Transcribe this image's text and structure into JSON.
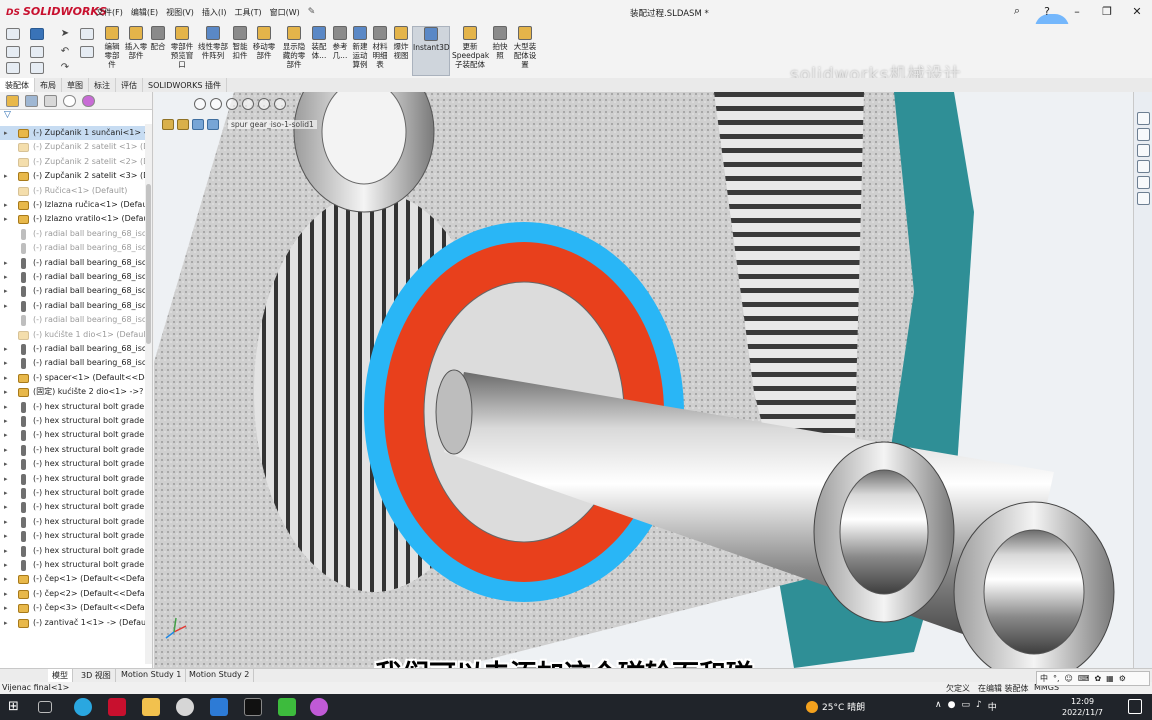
{
  "app": {
    "logo_ds": "DS",
    "logo_text": "SOLIDWORKS",
    "menus": [
      "文件(F)",
      "编辑(E)",
      "视图(V)",
      "插入(I)",
      "工具(T)",
      "窗口(W)"
    ],
    "document_title": "装配过程.SLDASM *",
    "clock_badge": "01:29"
  },
  "commands": [
    {
      "label": "编辑\n零部\n件",
      "color": "#e4b44a"
    },
    {
      "label": "插入零\n部件",
      "color": "#e4b44a"
    },
    {
      "label": "配合",
      "color": "#8a8a8a"
    },
    {
      "label": "零部件\n预览窗\n口",
      "color": "#e4b44a"
    },
    {
      "label": "线性零部\n件阵列",
      "color": "#5a88c6"
    },
    {
      "label": "智能\n扣件",
      "color": "#8a8a8a"
    },
    {
      "label": "移动零\n部件",
      "color": "#e4b44a"
    },
    {
      "label": "显示隐\n藏的零\n部件",
      "color": "#e4b44a"
    },
    {
      "label": "装配\n体...",
      "color": "#5a88c6"
    },
    {
      "label": "参考\n几...",
      "color": "#8a8a8a"
    },
    {
      "label": "新建\n运动\n算例",
      "color": "#5a88c6"
    },
    {
      "label": "材料\n明细\n表",
      "color": "#8a8a8a"
    },
    {
      "label": "爆炸\n视图",
      "color": "#e4b44a"
    },
    {
      "label": "Instant3D",
      "color": "#5a88c6",
      "active": true
    },
    {
      "label": "更新\nSpeedpak\n子装配体",
      "color": "#e4b44a"
    },
    {
      "label": "拍快\n照",
      "color": "#8a8a8a"
    },
    {
      "label": "大型装\n配体设\n置",
      "color": "#e4b44a"
    }
  ],
  "watermark": "solidworks机械设计",
  "tabs": [
    "装配体",
    "布局",
    "草图",
    "标注",
    "评估",
    "SOLIDWORKS 插件"
  ],
  "feature_tree": [
    {
      "label": "(-) Zupčanik 1 sunčani<1> -",
      "icon": "asm",
      "expand": "▸",
      "selected": true
    },
    {
      "label": "(-) Zupčanik 2 satelit <1> (D",
      "icon": "asm",
      "suppressed": true
    },
    {
      "label": "(-) Zupčanik 2 satelit <2> (D",
      "icon": "asm",
      "suppressed": true
    },
    {
      "label": "(-) Zupčanik 2 satelit <3> (D",
      "icon": "asm",
      "expand": "▸"
    },
    {
      "label": "(-) Ručica<1> (Default)",
      "icon": "asm",
      "suppressed": true
    },
    {
      "label": "(-) Izlazna ručica<1> (Defau",
      "icon": "asm",
      "expand": "▸"
    },
    {
      "label": "(-) Izlazno vratilo<1> (Defau",
      "icon": "asm",
      "expand": "▸"
    },
    {
      "label": "(-) radial ball bearing_68_isc",
      "icon": "bolt",
      "suppressed": true
    },
    {
      "label": "(-) radial ball bearing_68_isc",
      "icon": "bolt",
      "suppressed": true
    },
    {
      "label": "(-) radial ball bearing_68_isc",
      "icon": "bolt",
      "expand": "▸"
    },
    {
      "label": "(-) radial ball bearing_68_isc",
      "icon": "bolt",
      "expand": "▸"
    },
    {
      "label": "(-) radial ball bearing_68_isc",
      "icon": "bolt",
      "expand": "▸"
    },
    {
      "label": "(-) radial ball bearing_68_isc",
      "icon": "bolt",
      "expand": "▸"
    },
    {
      "label": "(-) radial ball bearing_68_isc",
      "icon": "bolt",
      "suppressed": true
    },
    {
      "label": "(-) kućište 1 dio<1> (Default",
      "icon": "asm",
      "suppressed": true
    },
    {
      "label": "(-) radial ball bearing_68_isc",
      "icon": "bolt",
      "expand": "▸"
    },
    {
      "label": "(-) radial ball bearing_68_isc",
      "icon": "bolt",
      "expand": "▸"
    },
    {
      "label": "(-) spacer<1> (Default<<De",
      "icon": "asm",
      "expand": "▸"
    },
    {
      "label": "(固定) kućište 2 dio<1> ->? (",
      "icon": "asm",
      "expand": "▸"
    },
    {
      "label": "(-) hex structural bolt grade",
      "icon": "bolt",
      "expand": "▸"
    },
    {
      "label": "(-) hex structural bolt grade",
      "icon": "bolt",
      "expand": "▸"
    },
    {
      "label": "(-) hex structural bolt grade",
      "icon": "bolt",
      "expand": "▸"
    },
    {
      "label": "(-) hex structural bolt grade",
      "icon": "bolt",
      "expand": "▸"
    },
    {
      "label": "(-) hex structural bolt grade",
      "icon": "bolt",
      "expand": "▸"
    },
    {
      "label": "(-) hex structural bolt grade",
      "icon": "bolt",
      "expand": "▸"
    },
    {
      "label": "(-) hex structural bolt grade",
      "icon": "bolt",
      "expand": "▸"
    },
    {
      "label": "(-) hex structural bolt grade",
      "icon": "bolt",
      "expand": "▸"
    },
    {
      "label": "(-) hex structural bolt grade",
      "icon": "bolt",
      "expand": "▸"
    },
    {
      "label": "(-) hex structural bolt grade",
      "icon": "bolt",
      "expand": "▸"
    },
    {
      "label": "(-) hex structural bolt grade",
      "icon": "bolt",
      "expand": "▸"
    },
    {
      "label": "(-) hex structural bolt grade",
      "icon": "bolt",
      "expand": "▸"
    },
    {
      "label": "(-) čep<1> (Default<<Defa",
      "icon": "asm",
      "expand": "▸"
    },
    {
      "label": "(-) čep<2> (Default<<Defau",
      "icon": "asm",
      "expand": "▸"
    },
    {
      "label": "(-) čep<3> (Default<<Defau",
      "icon": "asm",
      "expand": "▸"
    },
    {
      "label": "(-) zantivač 1<1> -> (Defau",
      "icon": "asm",
      "expand": "▸"
    }
  ],
  "breadcrumb": "spur gear_iso-1-solid1",
  "subtitle": "我们可以去添加这个磁轮面和磁",
  "bottom_tabs": [
    "模型",
    "3D 视图",
    "Motion Study 1",
    "Motion Study 2"
  ],
  "status": {
    "left": "Vijenac final<1>",
    "middle1": "欠定义",
    "middle2": "在编辑 装配体",
    "units": "MMGS"
  },
  "ime": [
    "中",
    "°,",
    "☺",
    "⌨",
    "✿",
    "▦",
    "⚙"
  ],
  "taskbar": {
    "weather": "25°C 晴朗",
    "time": "12:09",
    "date": "2022/11/7",
    "lang": "中"
  },
  "colors": {
    "gear_face": "#29b6f6",
    "gear_core": "#e8401c",
    "teal_housing": "#2f8f96"
  }
}
